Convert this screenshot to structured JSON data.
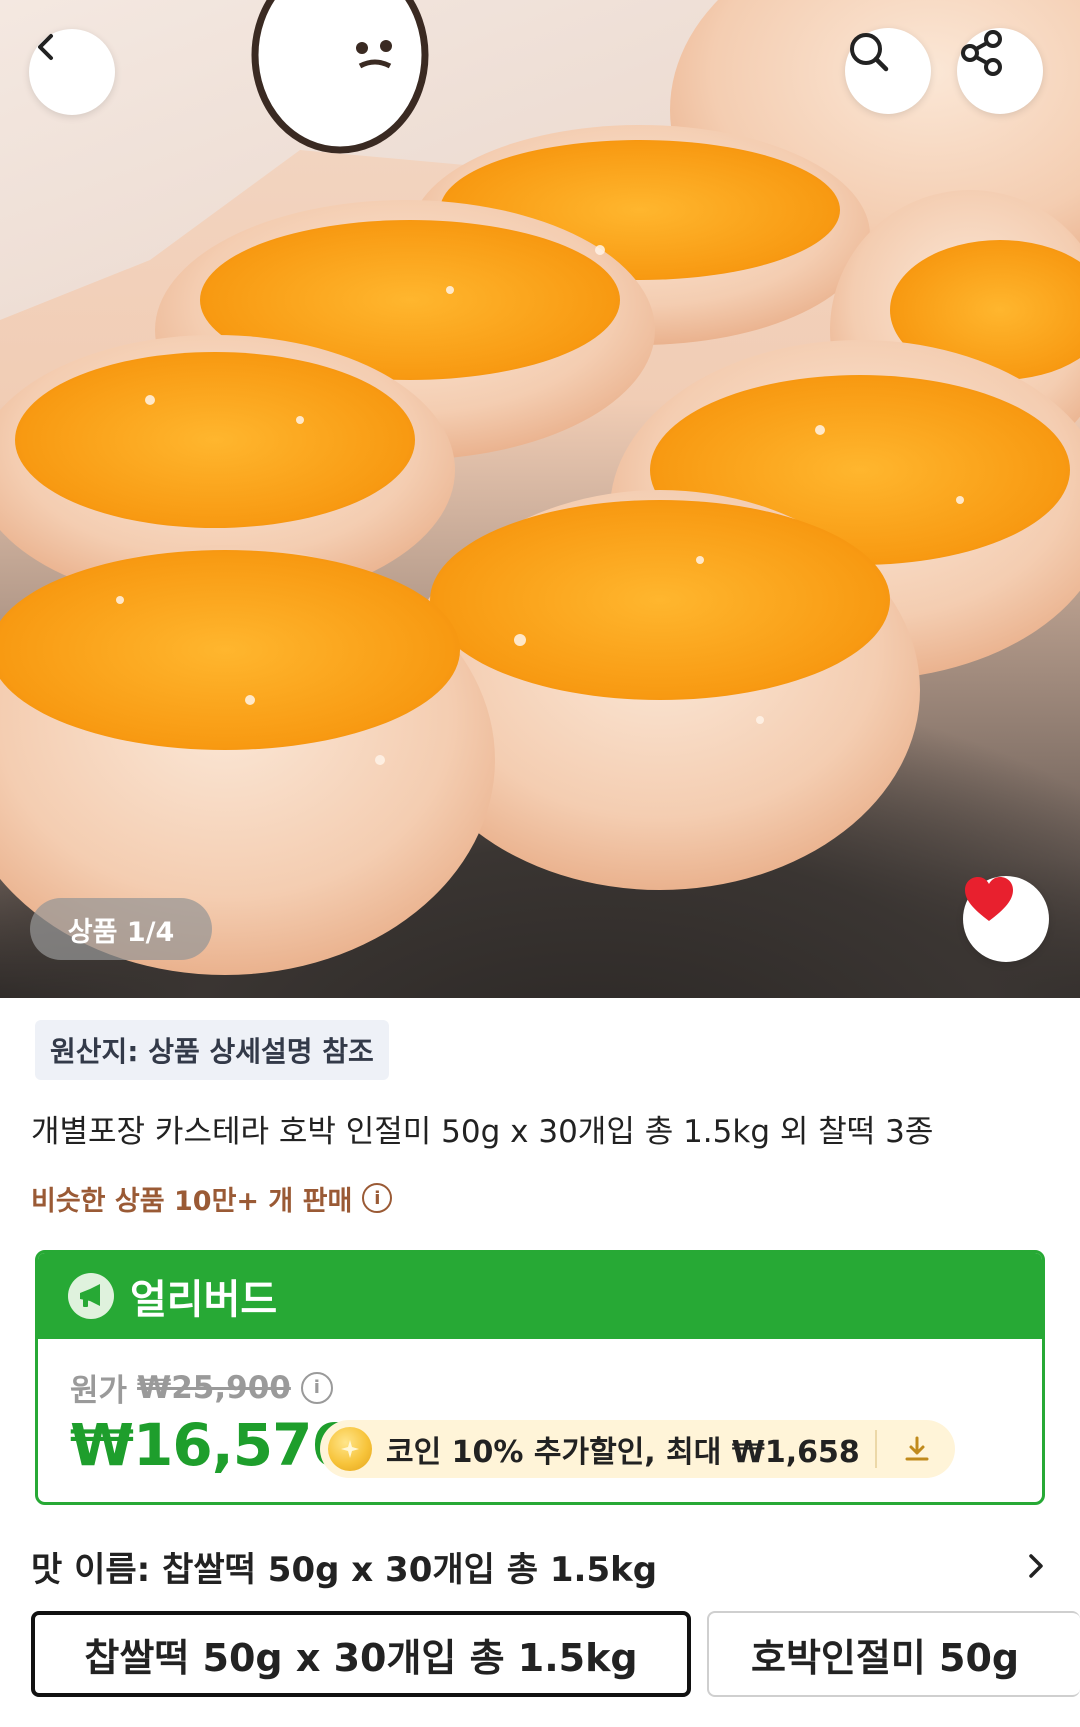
{
  "hero": {
    "image_description_icon": "product-photo",
    "counter": "상품 1/4"
  },
  "icons": {
    "back": "chevron-left-icon",
    "search": "search-icon",
    "share": "share-icon",
    "favorite": "heart-icon",
    "early_bird": "megaphone-icon",
    "coin": "coin-icon",
    "download": "download-icon",
    "chevron": "chevron-right-icon",
    "info": "info-icon"
  },
  "colors": {
    "green": "#27a935",
    "price_green": "#1e9e2c",
    "heart_red": "#e8202e",
    "sold_brown": "#9a5a35"
  },
  "product": {
    "origin": "원산지: 상품 상세설명 참조",
    "title": "개별포장 카스테라 호박 인절미 50g x 30개입 총 1.5kg 외 찰떡 3종",
    "sold_text": "비슷한 상품 10만+ 개 판매",
    "info_glyph": "i"
  },
  "price": {
    "early_bird_label": "얼리버드",
    "original_label": "원가",
    "original_price": "₩25,900",
    "sale_price": "₩16,576",
    "coin_text": "코인 10% 추가할인, 최대 ₩1,658"
  },
  "options": {
    "label": "맛 이름: 찹쌀떡 50g x 30개입 총 1.5kg",
    "chips": [
      {
        "label": "찹쌀떡 50g x 30개입 총 1.5kg",
        "selected": true
      },
      {
        "label": "호박인절미 50g",
        "selected": false
      }
    ]
  }
}
